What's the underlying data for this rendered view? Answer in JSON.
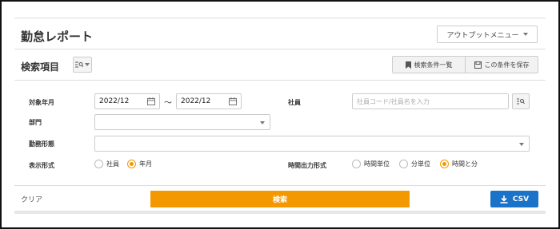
{
  "header": {
    "title": "勤怠レポート",
    "output_menu_label": "アウトプットメニュー"
  },
  "search_section": {
    "title": "検索項目",
    "saved_conditions_label": "検索条件一覧",
    "save_condition_label": "この条件を保存"
  },
  "form": {
    "target_month_label": "対象年月",
    "date_from": "2022/12",
    "date_to": "2022/12",
    "range_separator": "～",
    "employee_label": "社員",
    "employee_placeholder": "社員コード/社員名を入力",
    "department_label": "部門",
    "work_type_label": "勤務形態",
    "display_format_label": "表示形式",
    "display_format_options": [
      "社員",
      "年月"
    ],
    "display_format_selected": "年月",
    "time_output_label": "時間出力形式",
    "time_output_options": [
      "時間単位",
      "分単位",
      "時間と分"
    ],
    "time_output_selected": "時間と分"
  },
  "footer": {
    "clear_label": "クリア",
    "search_label": "検索",
    "csv_label": "CSV"
  },
  "colors": {
    "accent": "#f39800",
    "primary": "#1a73c8"
  }
}
